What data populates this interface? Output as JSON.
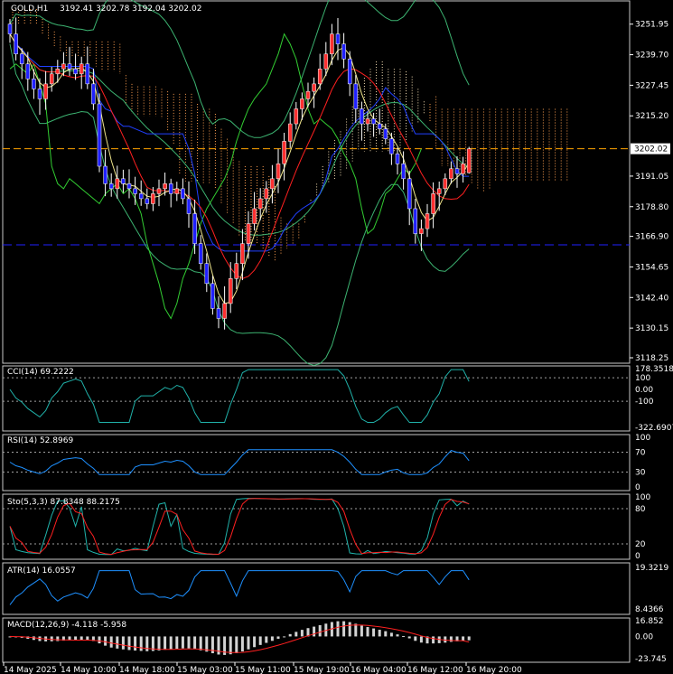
{
  "header": {
    "symbol": "GOLD,H1",
    "ohlc": "3192.41 3202.78 3192.04 3202.02"
  },
  "price_axis": {
    "ticks": [
      "3251.95",
      "3239.70",
      "3227.45",
      "3215.20",
      "3202.02",
      "3191.05",
      "3178.80",
      "3166.90",
      "3154.65",
      "3142.40",
      "3130.15",
      "3118.25"
    ],
    "current": "3202.02"
  },
  "time_axis": {
    "labels": [
      "14 May 2025",
      "14 May 10:00",
      "14 May 18:00",
      "15 May 03:00",
      "15 May 11:00",
      "15 May 19:00",
      "16 May 04:00",
      "16 May 12:00",
      "16 May 20:00"
    ]
  },
  "panels": {
    "cci": {
      "label": "CCI(14) 69.2222",
      "ticks": [
        "178.3518",
        "100",
        "0.00",
        "-100",
        "-322.6907"
      ]
    },
    "rsi": {
      "label": "RSI(14) 52.8969",
      "ticks": [
        "100",
        "70",
        "30",
        "0"
      ]
    },
    "sto": {
      "label": "Sto(5,3,3) 87.8348 88.2175",
      "ticks": [
        "100",
        "80",
        "20",
        "0"
      ]
    },
    "atr": {
      "label": "ATR(14) 16.0557",
      "ticks": [
        "19.3219",
        "8.4366"
      ]
    },
    "macd": {
      "label": "MACD(12,26,9) -4.118 -5.958",
      "ticks": [
        "16.852",
        "0.00",
        "-23.745"
      ]
    }
  },
  "chart_data": {
    "type": "candlestick",
    "symbol": "GOLD",
    "timeframe": "H1",
    "ohlc_last": [
      3192.41,
      3202.78,
      3192.04,
      3202.02
    ],
    "ylim": [
      3118.25,
      3258
    ],
    "close": [
      3248,
      3240,
      3236,
      3230,
      3226,
      3222,
      3228,
      3232,
      3234,
      3236,
      3234,
      3232,
      3236,
      3228,
      3220,
      3195,
      3188,
      3186,
      3190,
      3188,
      3186,
      3184,
      3182,
      3180,
      3184,
      3186,
      3188,
      3184,
      3186,
      3182,
      3176,
      3164,
      3156,
      3148,
      3138,
      3134,
      3140,
      3150,
      3156,
      3164,
      3172,
      3178,
      3182,
      3186,
      3190,
      3196,
      3205,
      3212,
      3218,
      3222,
      3225,
      3228,
      3234,
      3240,
      3248,
      3244,
      3238,
      3228,
      3218,
      3212,
      3214,
      3212,
      3210,
      3206,
      3200,
      3196,
      3190,
      3178,
      3168,
      3170,
      3176,
      3184,
      3186,
      3190,
      3194,
      3192,
      3196,
      3202
    ],
    "macd_hist_last": -4.118,
    "macd_signal_last": -5.958,
    "cci_last": 69.2222,
    "rsi_last": 52.8969,
    "sto_k_last": 87.8348,
    "sto_d_last": 88.2175,
    "atr_last": 16.0557,
    "colors": {
      "up": "#ff3030",
      "down": "#2020ff",
      "bull_wick": "#ffffff"
    }
  }
}
